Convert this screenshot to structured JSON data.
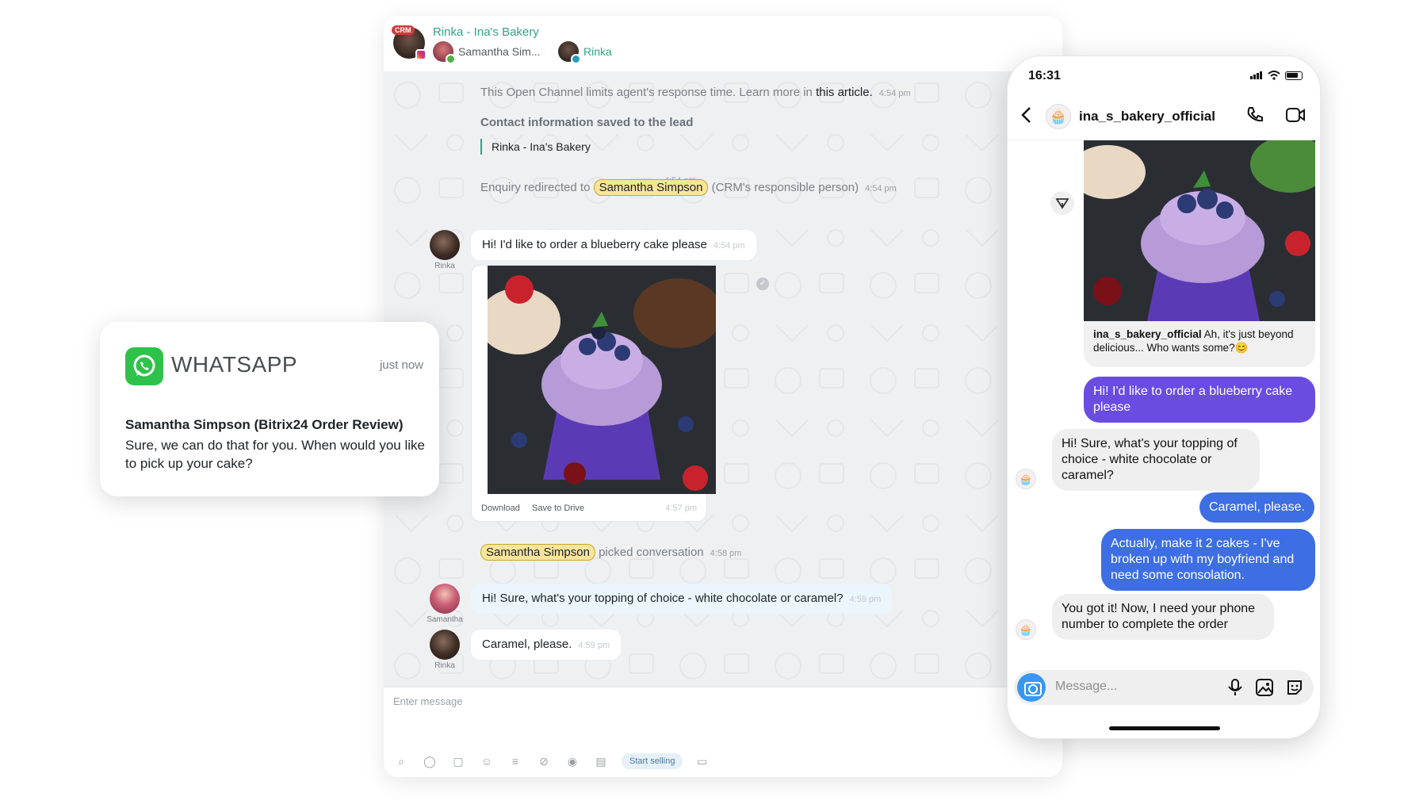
{
  "chat": {
    "crm_badge": "CRM",
    "title": "Rinka - Ina's Bakery",
    "header_users": [
      "Samantha Sim...",
      "Rinka"
    ],
    "notice_text": "This Open Channel limits agent's response time. Learn more in ",
    "notice_link": "this article.",
    "notice_time": "4:54 pm",
    "contact_title": "Contact information saved to the lead",
    "contact_name": "Rinka - Ina's Bakery",
    "contact_time": "4:54 pm",
    "redirect_prefix": "Enquiry redirected to",
    "redirect_person": "Samantha Simpson",
    "redirect_suffix": "(CRM's responsible person)",
    "redirect_time": "4:54 pm",
    "messages": [
      {
        "author": "Rinka",
        "text": "Hi! I'd like to order a blueberry cake please",
        "time": "4:54 pm"
      },
      {
        "author": "Samantha",
        "text": "Hi! Sure, what's your topping of choice - white chocolate or caramel?",
        "time": "4:59 pm"
      },
      {
        "author": "Rinka",
        "text": "Caramel, please.",
        "time": "4:59 pm"
      }
    ],
    "image_actions": [
      "Download",
      "Save to Drive"
    ],
    "image_time": "4:57 pm",
    "picked_person": "Samantha Simpson",
    "picked_text": "picked conversation",
    "picked_time": "4:58 pm",
    "composer_placeholder": "Enter message",
    "start_selling": "Start selling"
  },
  "whatsapp": {
    "app_name": "WHATSAPP",
    "time": "just now",
    "sender": "Samantha Simpson (Bitrix24 Order Review)",
    "body": "Sure, we can do that for you. When would you like to pick up your cake?"
  },
  "phone": {
    "status_time": "16:31",
    "username": "ina_s_bakery_official",
    "post_caption_user": "ina_s_bakery_official",
    "post_caption_text": " Ah, it's just beyond delicious... Who wants some?😊",
    "messages": [
      {
        "dir": "out",
        "text": "Hi! I'd like to order a blueberry cake please"
      },
      {
        "dir": "in",
        "text": "Hi! Sure, what's your topping of choice - white chocolate or caramel?"
      },
      {
        "dir": "out",
        "text": "Caramel, please."
      },
      {
        "dir": "out",
        "text": "Actually, make it 2 cakes - I've broken up with my boyfriend and need some consolation."
      },
      {
        "dir": "in",
        "text": "You got it! Now, I need your phone number to complete the order"
      }
    ],
    "compose_placeholder": "Message..."
  },
  "colors": {
    "bitrix_accent": "#2fa38a",
    "whatsapp_green": "#2fc24a",
    "ig_blue": "#3d6ee3",
    "ig_purple": "#6a4ce1"
  }
}
